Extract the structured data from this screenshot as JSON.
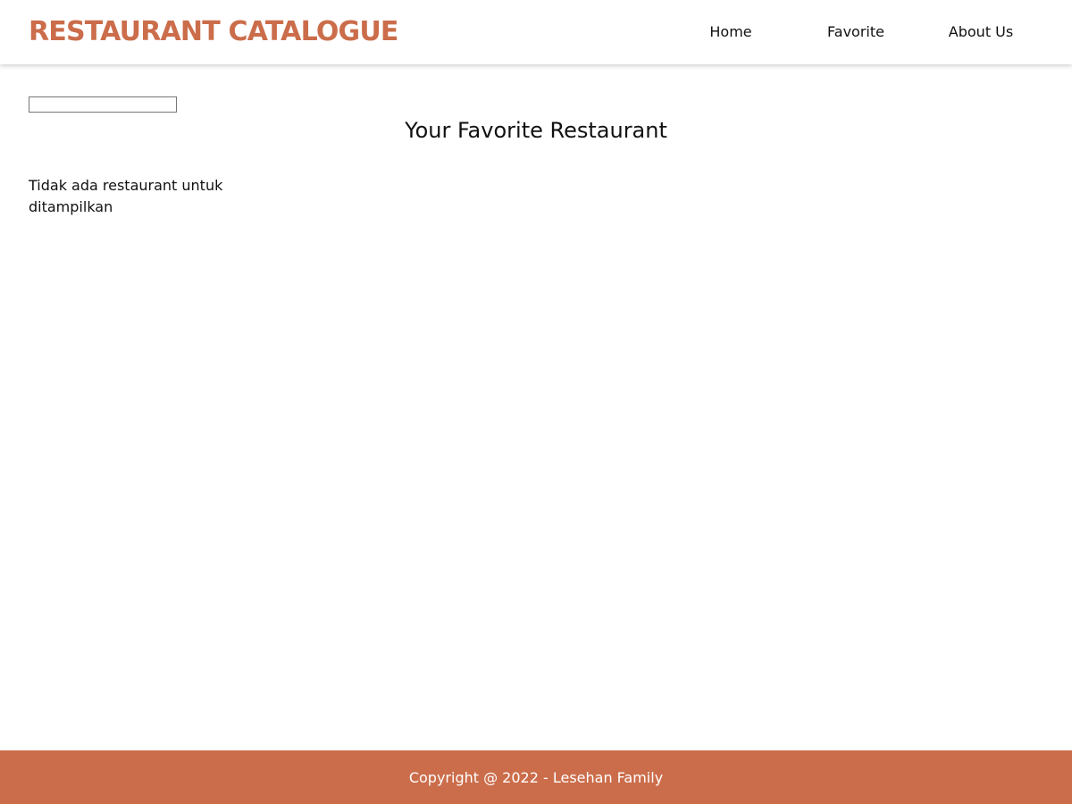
{
  "header": {
    "brand": "RESTAURANT CATALOGUE",
    "nav": [
      {
        "label": "Home"
      },
      {
        "label": "Favorite"
      },
      {
        "label": "About Us"
      }
    ]
  },
  "main": {
    "search": {
      "value": "",
      "placeholder": ""
    },
    "title": "Your Favorite Restaurant",
    "empty_message": "Tidak ada restaurant untuk ditampilkan"
  },
  "footer": {
    "copyright": "Copyright @ 2022 - Lesehan Family"
  },
  "colors": {
    "accent": "#CB6D4B",
    "text": "#111111",
    "background": "#FFFFFF"
  }
}
